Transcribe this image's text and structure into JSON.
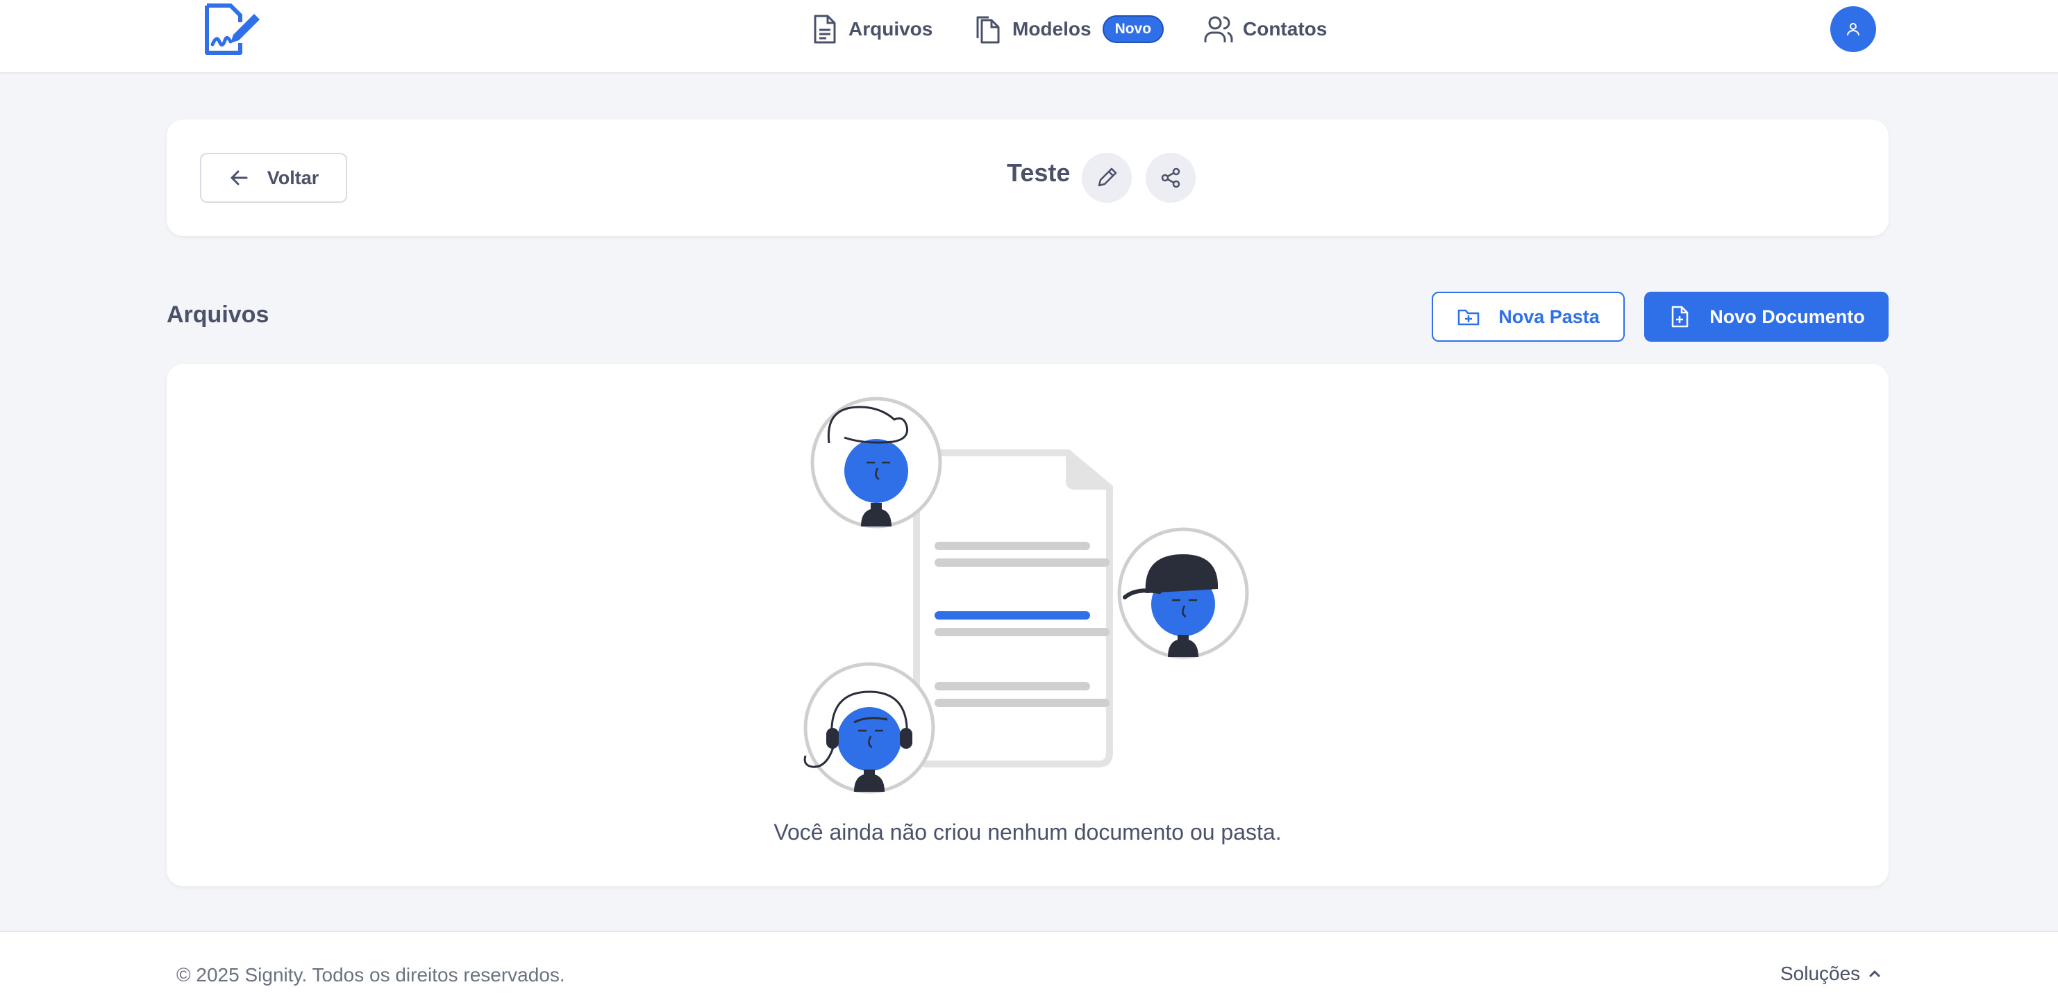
{
  "header": {
    "logo": "signity-logo-icon",
    "nav": [
      {
        "label": "Arquivos",
        "icon": "file-text-icon"
      },
      {
        "label": "Modelos",
        "icon": "files-icon",
        "badge": "Novo"
      },
      {
        "label": "Contatos",
        "icon": "users-icon"
      }
    ],
    "avatar_icon": "user-icon"
  },
  "title_bar": {
    "back_label": "Voltar",
    "title": "Teste"
  },
  "files": {
    "section_title": "Arquivos",
    "new_folder_label": "Nova Pasta",
    "new_document_label": "Novo Documento",
    "empty_message": "Você ainda não criou nenhum documento ou pasta."
  },
  "footer": {
    "copyright": "© 2025 Signity. Todos os direitos reservados.",
    "solutions_label": "Soluções"
  },
  "colors": {
    "accent": "#2f6fe8",
    "background": "#f4f5f8",
    "text": "#4a5168"
  }
}
